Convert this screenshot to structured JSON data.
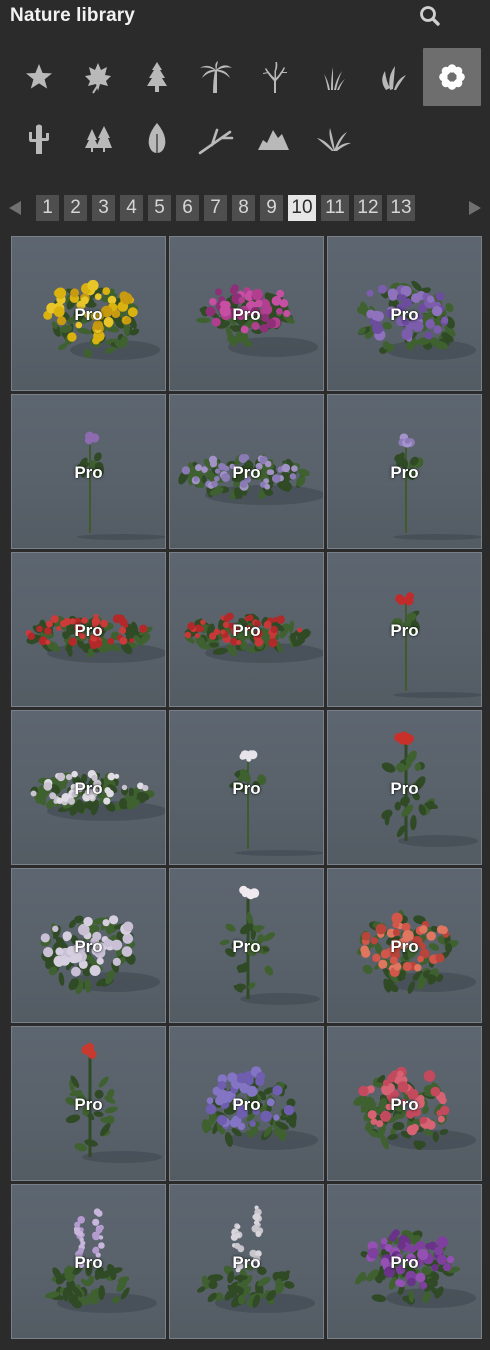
{
  "header": {
    "title": "Nature library"
  },
  "categories": [
    {
      "name": "favorites",
      "icon": "star-icon"
    },
    {
      "name": "leaf",
      "icon": "maple-leaf-icon"
    },
    {
      "name": "conifer",
      "icon": "pine-tree-icon"
    },
    {
      "name": "palm",
      "icon": "palm-tree-icon"
    },
    {
      "name": "bare-tree",
      "icon": "bare-tree-icon"
    },
    {
      "name": "grass",
      "icon": "grass-icon"
    },
    {
      "name": "shrub",
      "icon": "leaf-bush-icon"
    },
    {
      "name": "flowers",
      "icon": "flower-icon",
      "active": true
    },
    {
      "name": "cactus",
      "icon": "cactus-icon"
    },
    {
      "name": "forest",
      "icon": "trees-icon"
    },
    {
      "name": "single-leaf",
      "icon": "leaf-icon"
    },
    {
      "name": "branch",
      "icon": "branch-icon"
    },
    {
      "name": "rocks",
      "icon": "rocks-icon"
    },
    {
      "name": "fern",
      "icon": "fern-icon"
    }
  ],
  "pagination": {
    "pages": [
      "1",
      "2",
      "3",
      "4",
      "5",
      "6",
      "7",
      "8",
      "9",
      "10",
      "11",
      "12",
      "13"
    ],
    "current": "10"
  },
  "items": [
    {
      "badge": "Pro",
      "plant": "marigold-bush"
    },
    {
      "badge": "Pro",
      "plant": "magenta-flower-bush"
    },
    {
      "badge": "Pro",
      "plant": "purple-flower-bush"
    },
    {
      "badge": "Pro",
      "plant": "single-purple-stem"
    },
    {
      "badge": "Pro",
      "plant": "purple-ground-cover"
    },
    {
      "badge": "Pro",
      "plant": "single-lilac-stem"
    },
    {
      "badge": "Pro",
      "plant": "red-ground-cover"
    },
    {
      "badge": "Pro",
      "plant": "red-ground-cover-2"
    },
    {
      "badge": "Pro",
      "plant": "single-red-stem"
    },
    {
      "badge": "Pro",
      "plant": "white-ground-cover"
    },
    {
      "badge": "Pro",
      "plant": "single-white-stem"
    },
    {
      "badge": "Pro",
      "plant": "red-flower-plant"
    },
    {
      "badge": "Pro",
      "plant": "white-flower-bush"
    },
    {
      "badge": "Pro",
      "plant": "white-flower-plant"
    },
    {
      "badge": "Pro",
      "plant": "coral-flower-bush"
    },
    {
      "badge": "Pro",
      "plant": "red-flower-plant-2"
    },
    {
      "badge": "Pro",
      "plant": "violet-flower-bush"
    },
    {
      "badge": "Pro",
      "plant": "pink-flower-bush"
    },
    {
      "badge": "Pro",
      "plant": "lilac-spike-plant"
    },
    {
      "badge": "Pro",
      "plant": "white-spike-plant"
    },
    {
      "badge": "Pro",
      "plant": "deep-purple-bush"
    }
  ],
  "colors": {
    "background": "#2b2b2b",
    "activeCategory": "#6e6e6e",
    "pageButton": "#4e4e4e",
    "activePage": "#e6e6e6",
    "tile": "#5d6670"
  }
}
